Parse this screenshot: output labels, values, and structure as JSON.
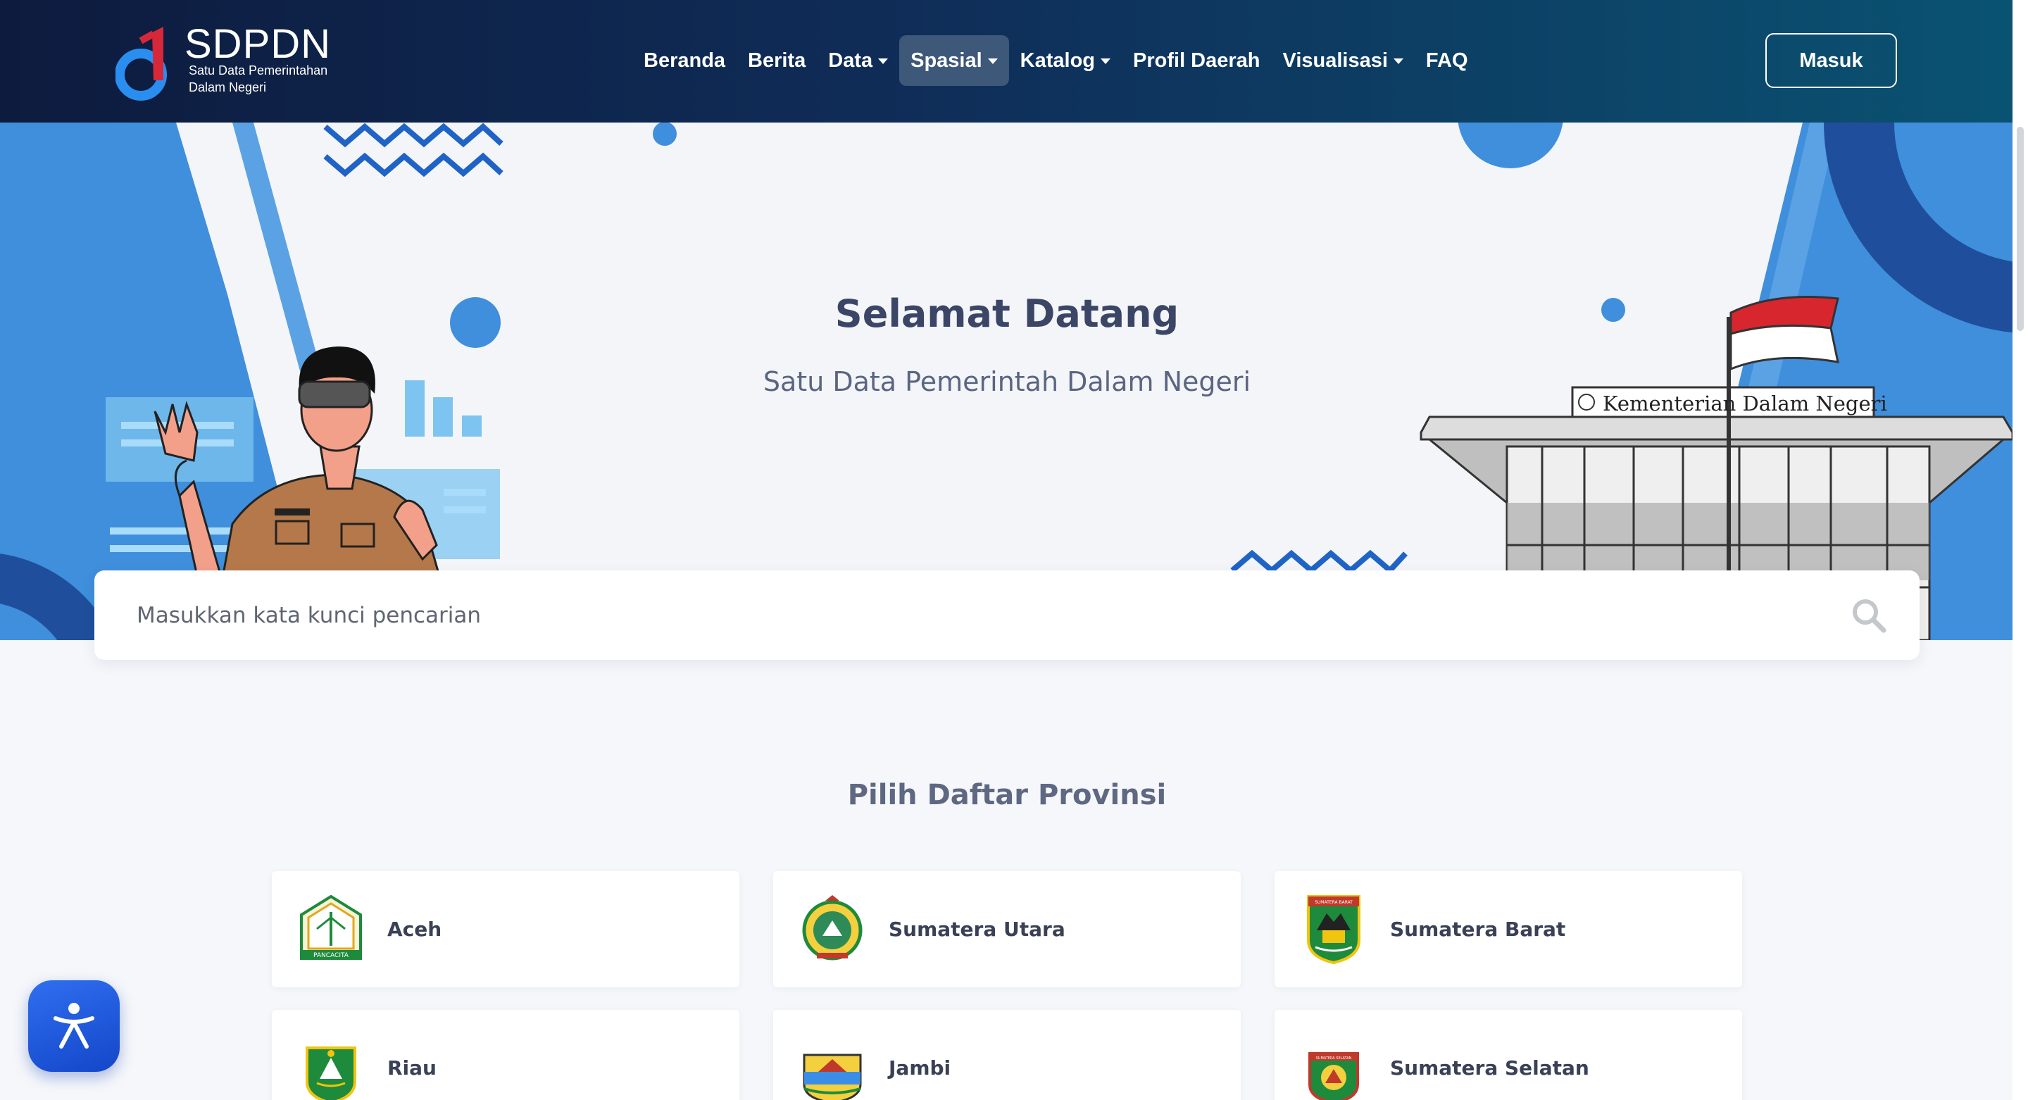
{
  "brand": {
    "title": "SDPDN",
    "subtitle_line1": "Satu Data Pemerintahan",
    "subtitle_line2": "Dalam Negeri"
  },
  "nav": {
    "items": [
      {
        "label": "Beranda",
        "dropdown": false,
        "active": false
      },
      {
        "label": "Berita",
        "dropdown": false,
        "active": false
      },
      {
        "label": "Data",
        "dropdown": true,
        "active": false
      },
      {
        "label": "Spasial",
        "dropdown": true,
        "active": true
      },
      {
        "label": "Katalog",
        "dropdown": true,
        "active": false
      },
      {
        "label": "Profil Daerah",
        "dropdown": false,
        "active": false
      },
      {
        "label": "Visualisasi",
        "dropdown": true,
        "active": false
      },
      {
        "label": "FAQ",
        "dropdown": false,
        "active": false
      }
    ],
    "login_label": "Masuk"
  },
  "hero": {
    "title": "Selamat Datang",
    "subtitle": "Satu Data Pemerintah Dalam Negeri",
    "building_sign": "Kementerian Dalam Negeri"
  },
  "search": {
    "placeholder": "Masukkan kata kunci pencarian",
    "value": ""
  },
  "provinces": {
    "title": "Pilih Daftar Provinsi",
    "items": [
      {
        "name": "Aceh",
        "emblem_text": "PANCACITA"
      },
      {
        "name": "Sumatera Utara",
        "emblem_text": ""
      },
      {
        "name": "Sumatera Barat",
        "emblem_text": "SUMATERA BARAT"
      },
      {
        "name": "Riau",
        "emblem_text": ""
      },
      {
        "name": "Jambi",
        "emblem_text": ""
      },
      {
        "name": "Sumatera Selatan",
        "emblem_text": "SUMATERA SELATAN"
      }
    ]
  },
  "icons": {
    "search": "search-icon",
    "accessibility": "accessibility-icon",
    "caret": "caret-down-icon"
  },
  "colors": {
    "navbar_start": "#0d1b3e",
    "navbar_end": "#0a5372",
    "accent_blue": "#2f7ad8",
    "text_dark": "#3b4566"
  }
}
